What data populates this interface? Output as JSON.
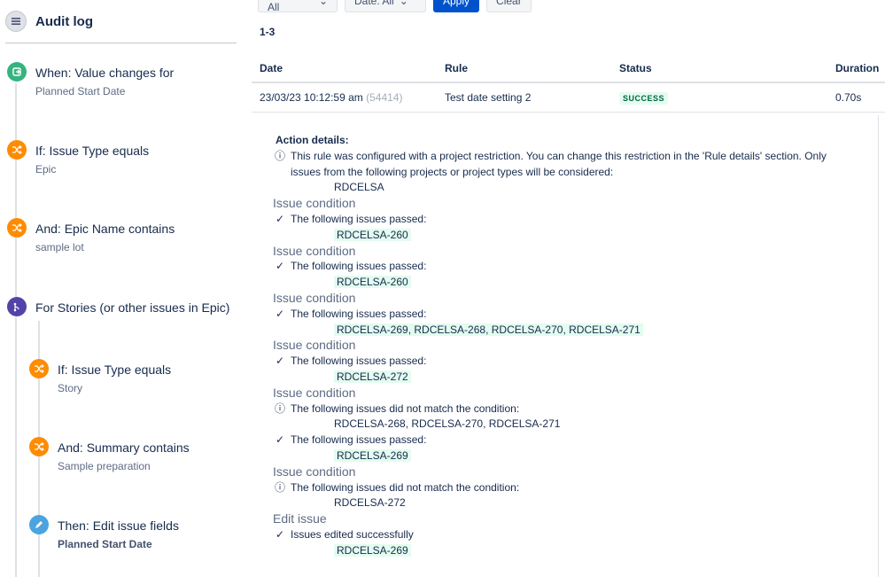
{
  "sidebar": {
    "title": "Audit log",
    "steps": [
      {
        "title": "When: Value changes for",
        "subtitle": "Planned Start Date",
        "icon": "trigger-icon",
        "color": "#36b37e"
      },
      {
        "title": "If: Issue Type equals",
        "subtitle": "Epic",
        "icon": "condition-icon",
        "color": "#ff8b00"
      },
      {
        "title": "And: Epic Name contains",
        "subtitle": "sample lot",
        "icon": "condition-icon",
        "color": "#ff8b00"
      },
      {
        "title": "For Stories (or other issues in Epic)",
        "subtitle": "",
        "icon": "branch-icon",
        "color": "#5243aa"
      },
      {
        "title": "If: Issue Type equals",
        "subtitle": "Story",
        "icon": "condition-icon",
        "color": "#ff8b00"
      },
      {
        "title": "And: Summary contains",
        "subtitle": "Sample preparation",
        "icon": "condition-icon",
        "color": "#ff8b00"
      },
      {
        "title": "Then: Edit issue fields",
        "subtitle": "Planned Start Date",
        "icon": "edit-icon",
        "color": "#4ca3e0"
      }
    ]
  },
  "filters": {
    "status": "Status: All",
    "date": "Date: All",
    "apply": "Apply",
    "clear": "Clear"
  },
  "range": "1-3",
  "table": {
    "headers": [
      "Date",
      "Rule",
      "Status",
      "Duration"
    ],
    "row": {
      "date": "23/03/23 10:12:59 am",
      "id": "(54414)",
      "rule": "Test date setting 2",
      "status": "SUCCESS",
      "duration": "0.70s"
    }
  },
  "details": {
    "heading": "Action details:",
    "restriction_line1": "This rule was configured with a project restriction. You can change this restriction in the 'Rule details' section. Only",
    "restriction_line2": "issues from the following projects or project types will be considered:",
    "project": "RDCELSA",
    "issue_condition": "Issue condition",
    "passed": "The following issues passed:",
    "not_match": "The following issues did not match the condition:",
    "edit_issue": "Edit issue",
    "edited_ok": "Issues edited successfully",
    "blocks": [
      {
        "passed": "RDCELSA-260"
      },
      {
        "passed": "RDCELSA-260"
      },
      {
        "passed": "RDCELSA-269, RDCELSA-268, RDCELSA-270, RDCELSA-271"
      },
      {
        "passed": "RDCELSA-272"
      },
      {
        "notmatch": "RDCELSA-268, RDCELSA-270, RDCELSA-271",
        "passed": "RDCELSA-269"
      },
      {
        "notmatch": "RDCELSA-272"
      }
    ],
    "edited": "RDCELSA-269"
  }
}
